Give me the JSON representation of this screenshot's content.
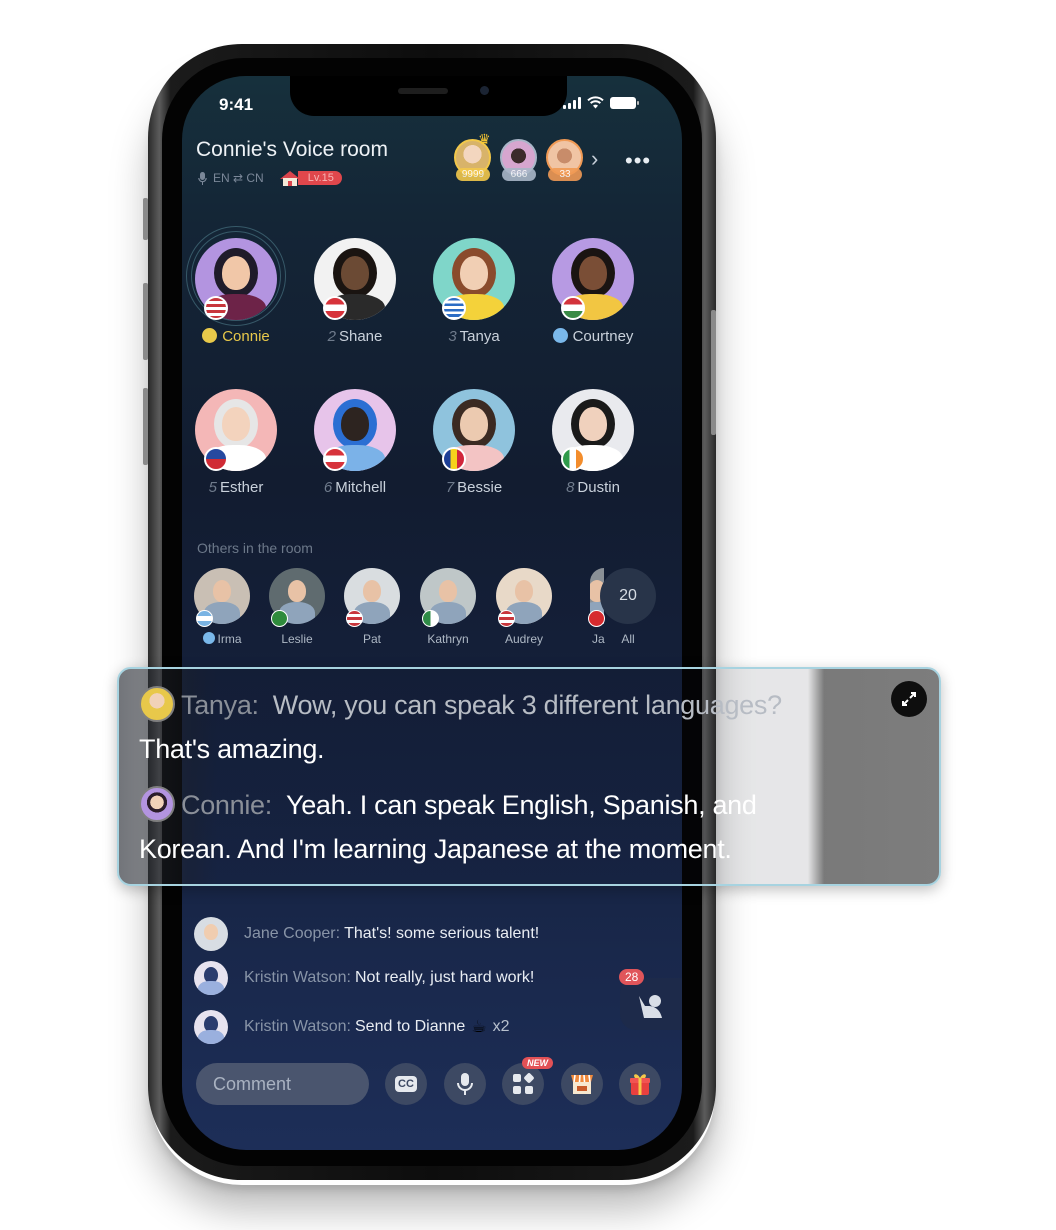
{
  "status_bar": {
    "time": "9:41"
  },
  "header": {
    "room_title": "Connie's Voice room",
    "language_pair": "EN ⇄ CN",
    "level": "Lv.15",
    "top_fans": [
      {
        "name": "top-fan-1",
        "count": "9999",
        "color": "#f2c84b"
      },
      {
        "name": "top-fan-2",
        "count": "666",
        "color": "#a9b6c8"
      },
      {
        "name": "top-fan-3",
        "count": "33",
        "color": "#f09a55"
      }
    ],
    "chevron": "›",
    "more": "•••"
  },
  "speakers": [
    {
      "seat": "",
      "name": "Connie",
      "role": "host",
      "flag": "us",
      "bg": "#b394e0"
    },
    {
      "seat": "2",
      "name": "Shane",
      "role": "",
      "flag": "at",
      "bg": "#f2f2f2"
    },
    {
      "seat": "3",
      "name": "Tanya",
      "role": "",
      "flag": "gr",
      "bg": "#7fd6c9"
    },
    {
      "seat": "",
      "name": "Courtney",
      "role": "admin",
      "flag": "hu",
      "bg": "#b79ae3"
    },
    {
      "seat": "5",
      "name": "Esther",
      "role": "",
      "flag": "li",
      "bg": "#f4b7b7"
    },
    {
      "seat": "6",
      "name": "Mitchell",
      "role": "",
      "flag": "at",
      "bg": "#e7c4ea"
    },
    {
      "seat": "7",
      "name": "Bessie",
      "role": "",
      "flag": "ro",
      "bg": "#8fc3dd"
    },
    {
      "seat": "8",
      "name": "Dustin",
      "role": "",
      "flag": "ie",
      "bg": "#e9eaee"
    }
  ],
  "others": {
    "title": "Others in the room",
    "members": [
      {
        "name": "Irma",
        "role": "admin",
        "flag": "ar"
      },
      {
        "name": "Leslie",
        "role": "",
        "flag": "sa"
      },
      {
        "name": "Pat",
        "role": "",
        "flag": "us"
      },
      {
        "name": "Kathryn",
        "role": "",
        "flag": "dz"
      },
      {
        "name": "Audrey",
        "role": "",
        "flag": "us"
      },
      {
        "name": "Ja",
        "role": "",
        "flag": "tr"
      }
    ],
    "all_count": "20",
    "all_label": "All"
  },
  "caption": {
    "lines": [
      {
        "speaker": "Tanya:",
        "text": "Wow, you can speak 3 different languages?",
        "cont": "That's amazing."
      },
      {
        "speaker": "Connie:",
        "text": "Yeah. I can speak English, Spanish, and",
        "cont": "Korean. And I'm learning Japanese at the moment."
      }
    ]
  },
  "chat": [
    {
      "user": "Jane Cooper:",
      "message": "That's! some serious talent!"
    },
    {
      "user": "Kristin Watson:",
      "message": "Not really, just hard work!"
    },
    {
      "user": "Kristin Watson:",
      "message": "Send to Dianne",
      "gift": "☕",
      "gift_count": "x2"
    }
  ],
  "raise_hand": {
    "count": "28"
  },
  "bottom_bar": {
    "comment_placeholder": "Comment",
    "cc_label": "CC",
    "new_badge": "NEW"
  }
}
